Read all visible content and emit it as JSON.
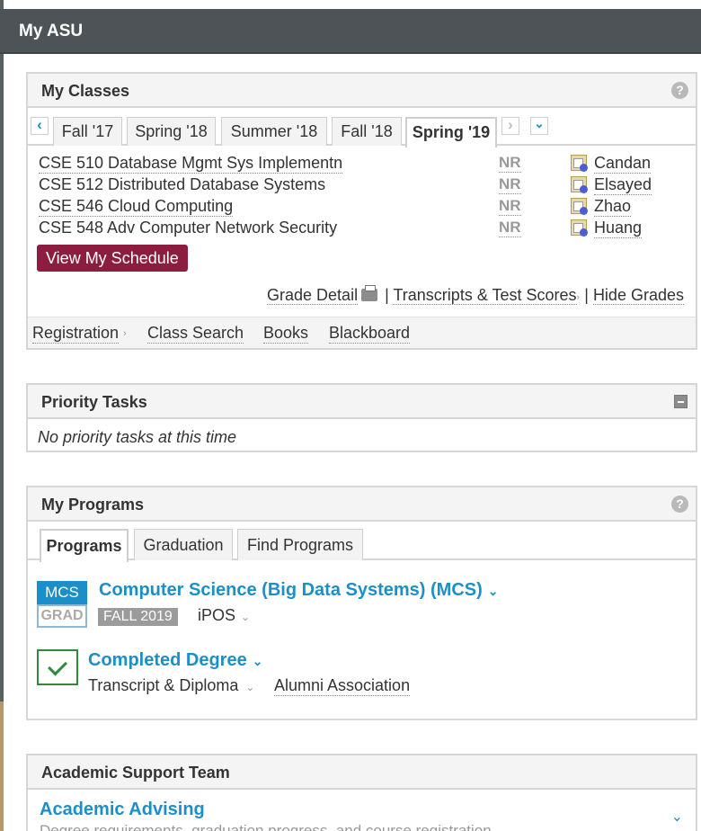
{
  "header": {
    "title": "My ASU"
  },
  "classes": {
    "title": "My Classes",
    "help_icon": "question-icon",
    "nav_prev": "‹",
    "nav_next": "›",
    "nav_menu": "⌄",
    "terms": [
      "Fall '17",
      "Spring '18",
      "Summer '18",
      "Fall '18",
      "Spring '19"
    ],
    "active_term": "Spring '19",
    "rows": [
      {
        "name": "CSE 510 Database Mgmt Sys Implementn",
        "grade": "NR",
        "instructor": "Candan"
      },
      {
        "name": "CSE 512 Distributed Database Systems",
        "grade": "NR",
        "instructor": "Elsayed"
      },
      {
        "name": "CSE 546 Cloud Computing",
        "grade": "NR",
        "instructor": "Zhao"
      },
      {
        "name": "CSE 548 Adv Computer Network Security",
        "grade": "NR",
        "instructor": "Huang"
      }
    ],
    "schedule_button": "View My Schedule",
    "grade_detail": "Grade Detail",
    "sep": "|",
    "transcripts": "Transcripts & Test Scores",
    "hide_grades": "Hide Grades",
    "footer_links": [
      "Registration",
      "Class Search",
      "Books",
      "Blackboard"
    ],
    "accent": "#8c1d40"
  },
  "priority": {
    "title": "Priority Tasks",
    "empty_text": "No priority tasks at this time"
  },
  "programs": {
    "title": "My Programs",
    "tabs": [
      "Programs",
      "Graduation",
      "Find Programs"
    ],
    "active_tab": "Programs",
    "program": {
      "badge_top": "MCS",
      "badge_bottom": "GRAD",
      "name": "Computer Science (Big Data Systems) (MCS)",
      "term": "FALL 2019",
      "ipos": "iPOS"
    },
    "degree": {
      "title": "Completed Degree",
      "transcript": "Transcript & Diploma",
      "alumni": "Alumni Association"
    },
    "link_color": "#1d8fc8"
  },
  "support": {
    "title": "Academic Support Team",
    "advising_title": "Academic Advising",
    "advising_desc": "Degree requirements, graduation progress, and course registration"
  }
}
